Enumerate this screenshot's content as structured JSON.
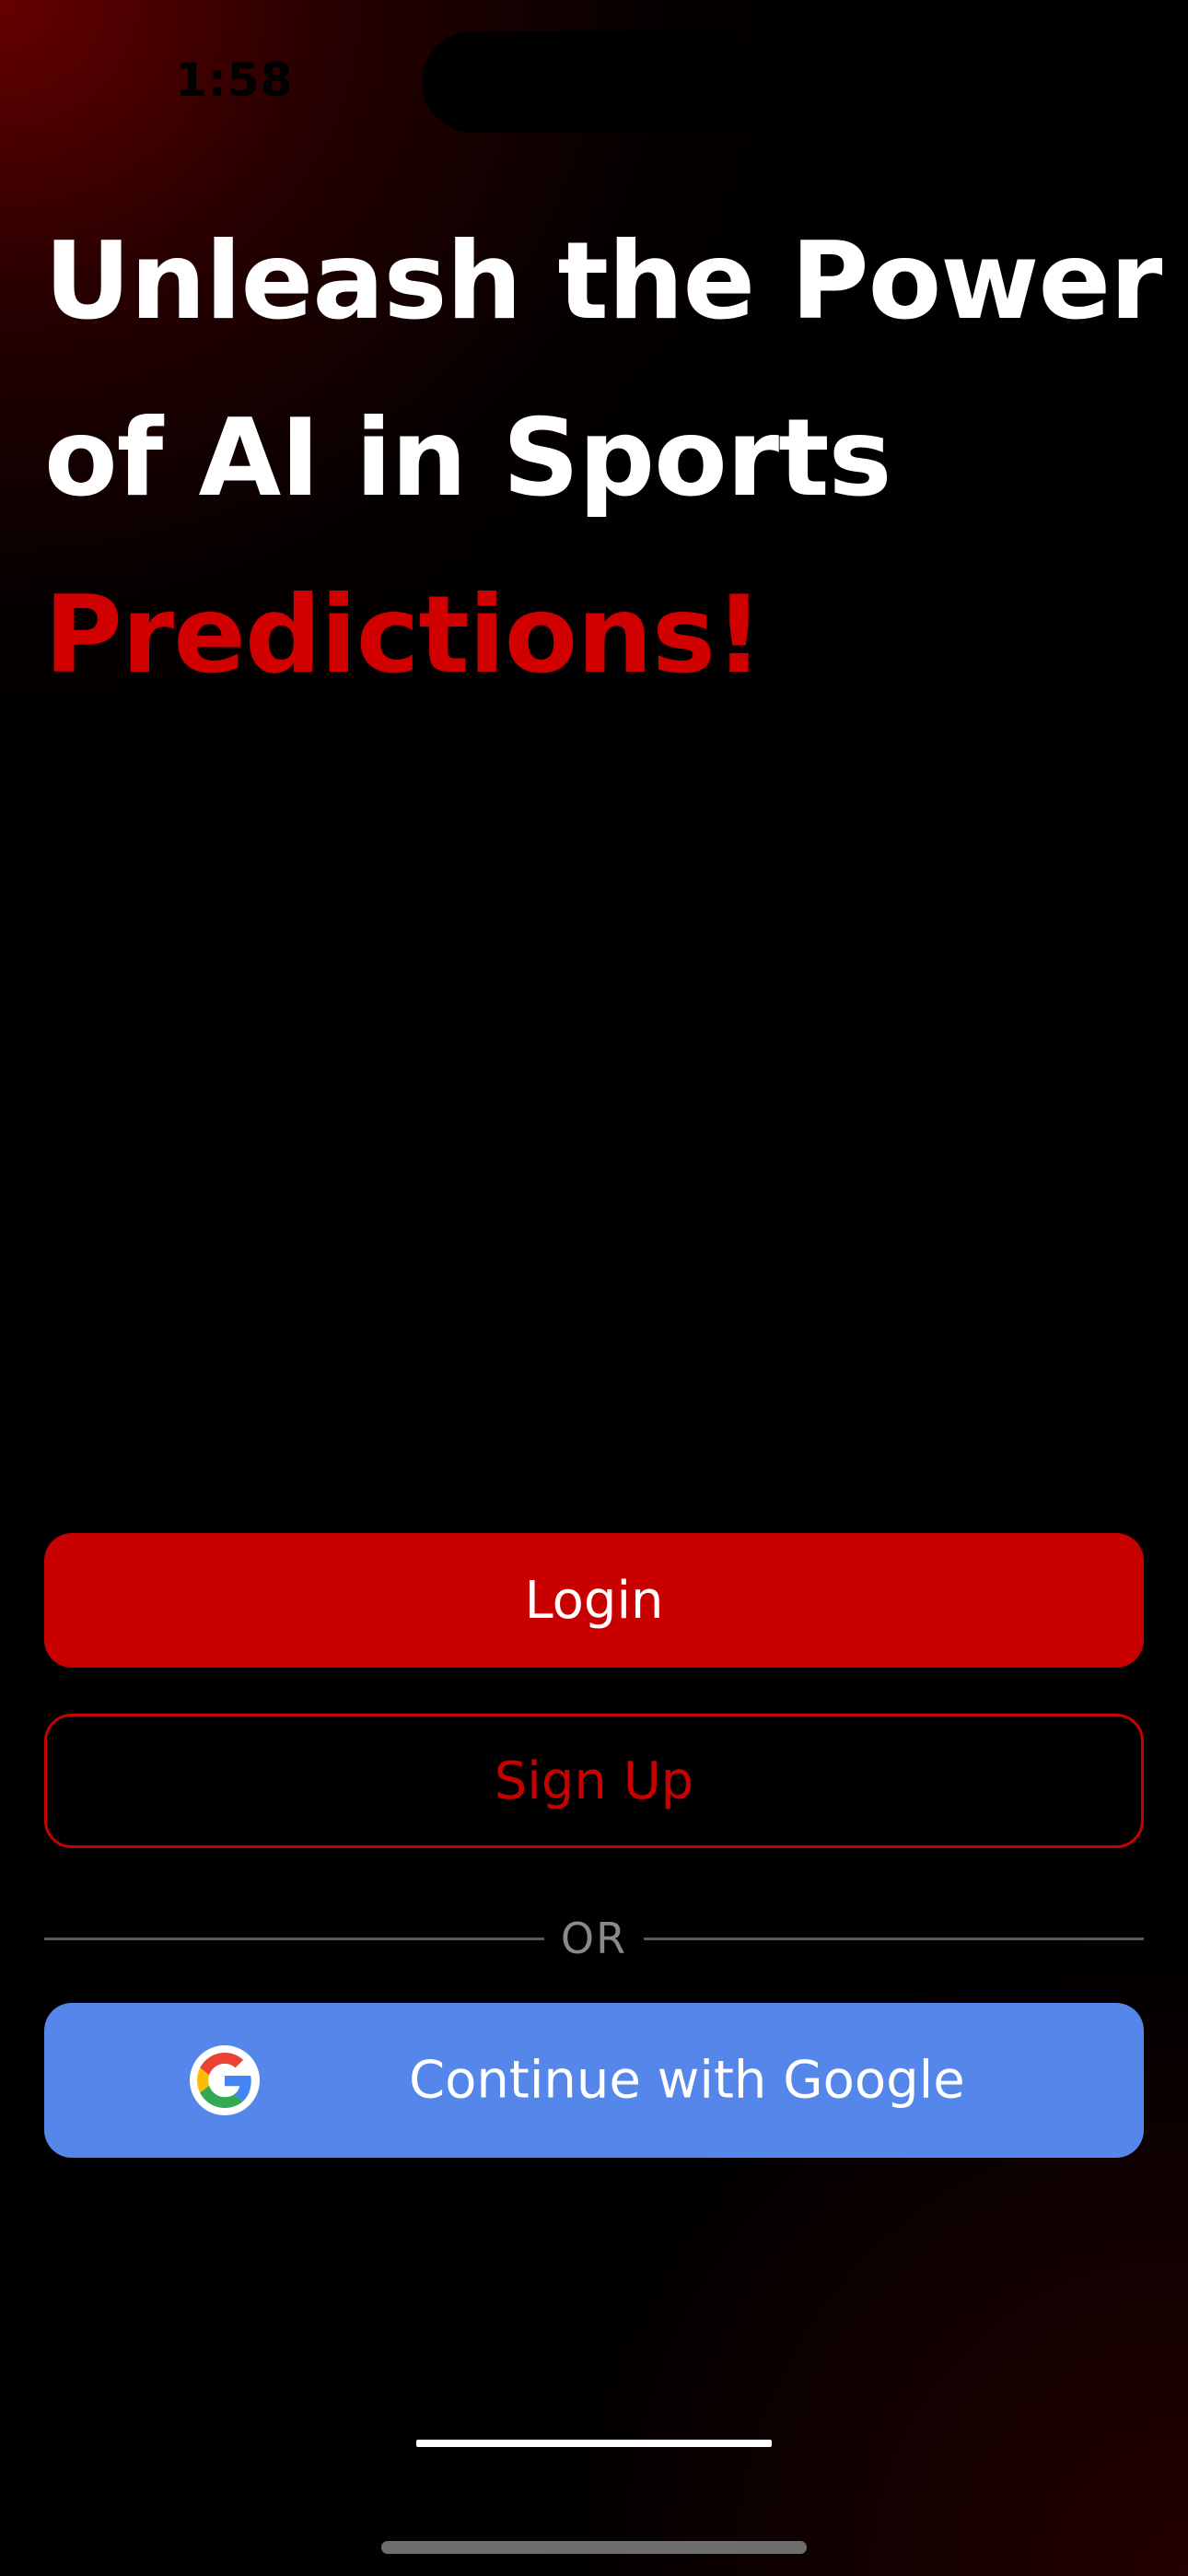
{
  "status_bar": {
    "time": "1:58"
  },
  "hero": {
    "line1": "Unleash the Power",
    "line2": "of AI in Sports",
    "line3": "Predictions!"
  },
  "actions": {
    "login_label": "Login",
    "signup_label": "Sign Up",
    "divider_label": "OR",
    "google_label": "Continue with Google"
  },
  "colors": {
    "accent": "#c80000",
    "google_button": "#5586ea",
    "background": "#000000"
  },
  "icons": {
    "google": "google-g-icon"
  }
}
